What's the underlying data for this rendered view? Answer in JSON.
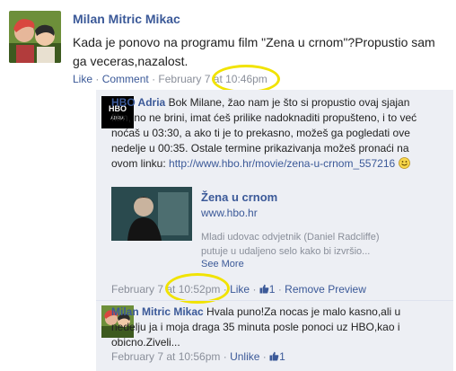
{
  "post": {
    "author": "Milan Mitric Mikac",
    "text": "Kada je ponovo na programu film \"Zena u crnom\"?Propustio sam ga veceras,nazalost.",
    "like": "Like",
    "comment": "Comment",
    "timestamp": "February 7 at 10:46pm"
  },
  "comment1": {
    "author": "HBO Adria",
    "text": "Bok Milane, žao nam je što si propustio ovaj sjajan film, no ne brini, imat ćeš prilike nadoknaditi propušteno, i to već noćaš u 03:30, a ako ti je to prekasno, možeš ga pogledati ove nedelje u 00:35. Ostale termine prikazivanja možeš pronaći na ovom linku: ",
    "link_url": "http://www.hbo.hr/movie/zena-u-crnom_557216",
    "avatar_text": "HBO ADRIA",
    "preview": {
      "title": "Žena u crnom",
      "domain": "www.hbo.hr",
      "description": "Mladi udovac odvjetnik (Daniel Radcliffe) putuje u udaljeno selo kako bi izvršio...",
      "see_more": "See More"
    },
    "timestamp": "February 7 at 10:52pm",
    "like": "Like",
    "like_count": "1",
    "remove_preview": "Remove Preview"
  },
  "comment2": {
    "author": "Milan Mitric Mikac",
    "text": "Hvala puno!Za nocas je malo kasno,ali u nedelju ja i moja draga 35 minuta posle ponoci uz HBO,kao i obicno.Ziveli...",
    "timestamp": "February 7 at 10:56pm",
    "unlike": "Unlike",
    "like_count": "1"
  },
  "separator": "·",
  "colors": {
    "link": "#3b5998",
    "meta": "#8a8f9a",
    "panel": "#edeff4",
    "highlight": "#f1e300"
  }
}
